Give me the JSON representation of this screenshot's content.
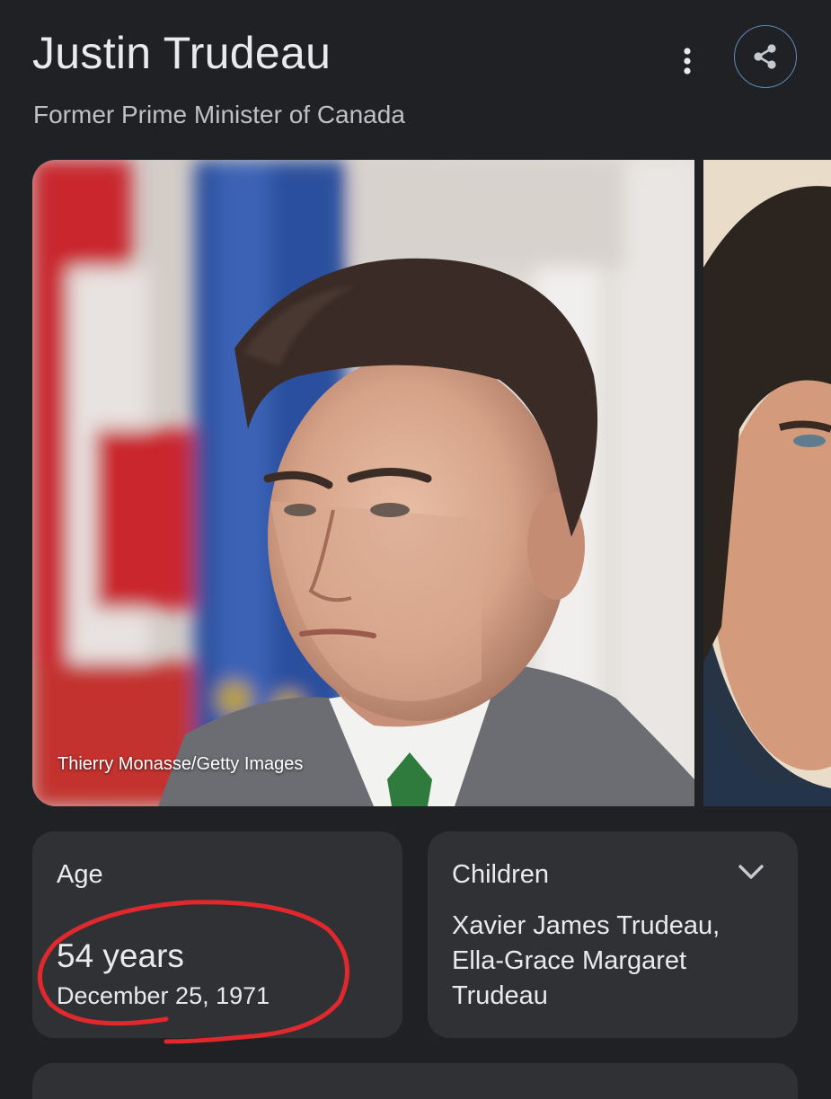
{
  "header": {
    "title": "Justin Trudeau",
    "subtitle": "Former Prime Minister of Canada"
  },
  "icons": {
    "more": "more-vert-icon",
    "share": "share-icon",
    "expand": "chevron-down-icon"
  },
  "images": {
    "main_credit": "Thierry Monasse/Getty Images"
  },
  "cards": {
    "age": {
      "label": "Age",
      "value": "54 years",
      "date": "December 25, 1971"
    },
    "children": {
      "label": "Children",
      "value": "Xavier James Trudeau, Ella-Grace Margaret Trudeau"
    }
  },
  "colors": {
    "background": "#202124",
    "card": "#303134",
    "annotation": "#e0282d"
  }
}
